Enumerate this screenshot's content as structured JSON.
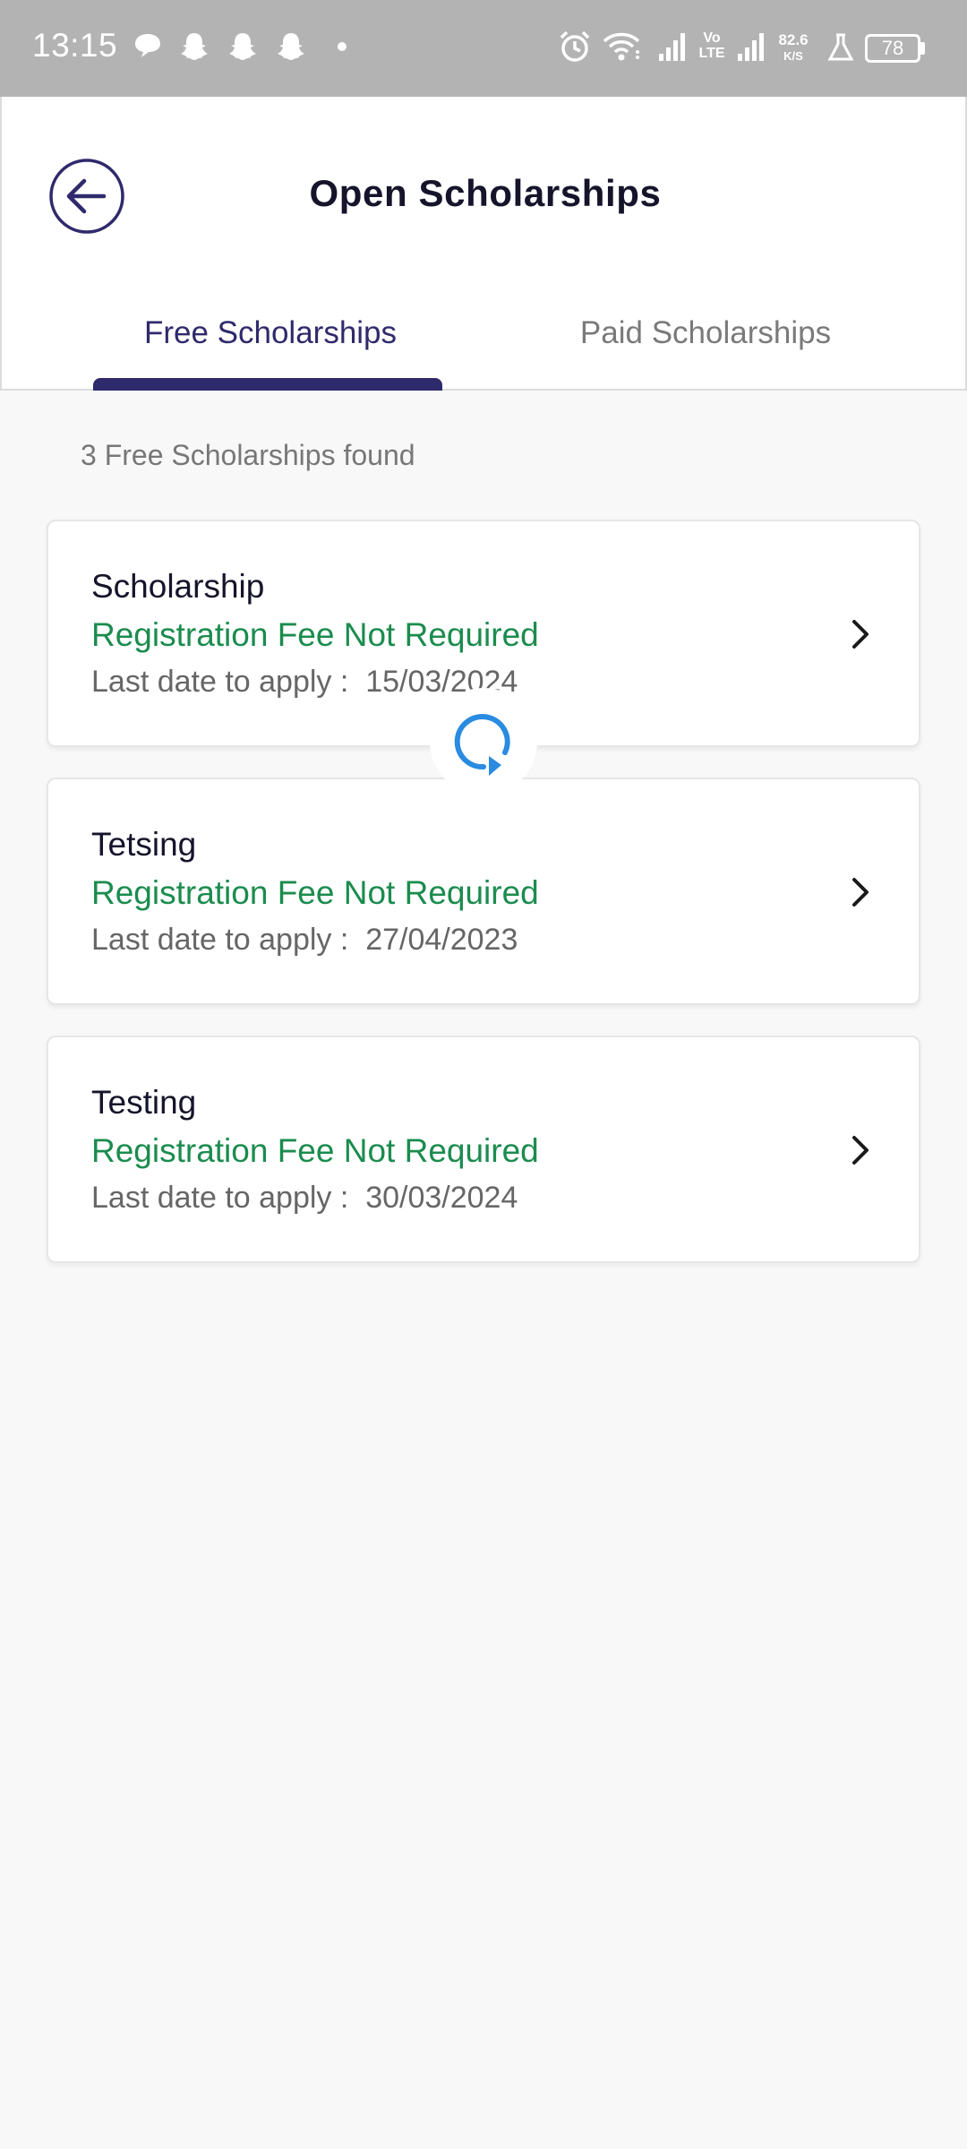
{
  "status_bar": {
    "time": "13:15",
    "speed_value": "82.6",
    "speed_unit": "K/S",
    "battery": "78",
    "volte_top": "Vo",
    "volte_bottom": "LTE"
  },
  "header": {
    "title": "Open Scholarships",
    "tabs": [
      {
        "label": "Free Scholarships",
        "active": true
      },
      {
        "label": "Paid Scholarships",
        "active": false
      }
    ]
  },
  "content": {
    "found_text": "3 Free Scholarships found",
    "date_prefix": "Last date to apply :  ",
    "cards": [
      {
        "title": "Scholarship",
        "fee": "Registration Fee Not Required",
        "date": "15/03/2024"
      },
      {
        "title": "Tetsing",
        "fee": "Registration Fee Not Required",
        "date": "27/04/2023"
      },
      {
        "title": "Testing",
        "fee": "Registration Fee Not Required",
        "date": "30/03/2024"
      }
    ]
  },
  "colors": {
    "accent": "#2f2a6c",
    "fee_green": "#1b8c4e",
    "spinner_blue": "#2a8be0",
    "status_bar_bg": "#b3b3b3"
  }
}
